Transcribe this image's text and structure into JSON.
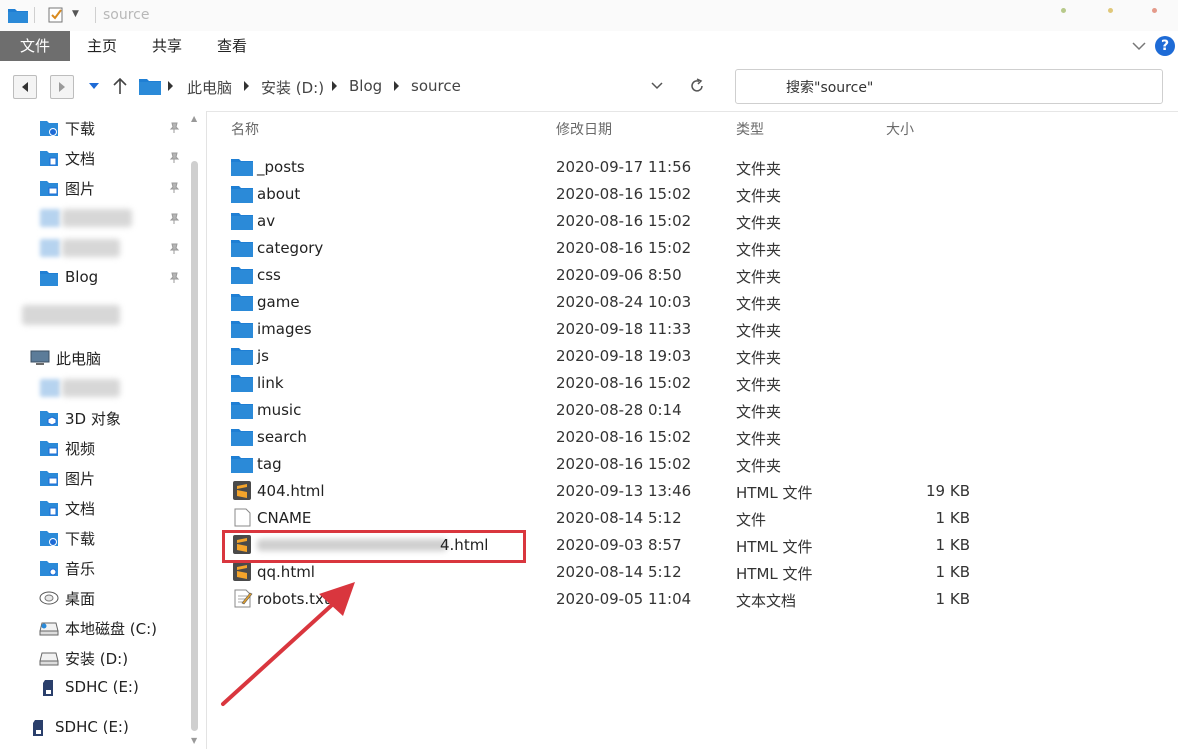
{
  "window": {
    "title": "source"
  },
  "ribbon": {
    "tabs": [
      "文件",
      "主页",
      "共享",
      "查看"
    ],
    "help": "?"
  },
  "address": {
    "breadcrumbs": [
      "此电脑",
      "安装 (D:)",
      "Blog",
      "source"
    ],
    "search_placeholder": "搜索\"source\""
  },
  "nav": {
    "quick_access": [
      {
        "label": "下载",
        "icon": "download-icon",
        "pinned": true
      },
      {
        "label": "文档",
        "icon": "document-icon",
        "pinned": true
      },
      {
        "label": "图片",
        "icon": "picture-icon",
        "pinned": true
      },
      {
        "label": "Blog",
        "icon": "folder-icon",
        "pinned": true
      }
    ],
    "this_pc": "此电脑",
    "pc_items": [
      {
        "label": "3D 对象",
        "icon": "3d-objects-icon"
      },
      {
        "label": "视频",
        "icon": "video-icon"
      },
      {
        "label": "图片",
        "icon": "picture-icon"
      },
      {
        "label": "文档",
        "icon": "document-icon"
      },
      {
        "label": "下载",
        "icon": "download-icon"
      },
      {
        "label": "音乐",
        "icon": "music-icon"
      },
      {
        "label": "桌面",
        "icon": "desktop-icon"
      },
      {
        "label": "本地磁盘 (C:)",
        "icon": "drive-icon"
      },
      {
        "label": "安装 (D:)",
        "icon": "drive-icon"
      },
      {
        "label": "SDHC (E:)",
        "icon": "sd-card-icon"
      }
    ],
    "extra": {
      "label": "SDHC (E:)",
      "icon": "sd-card-icon"
    }
  },
  "columns": {
    "name": "名称",
    "date": "修改日期",
    "type": "类型",
    "size": "大小"
  },
  "files": [
    {
      "name": "_posts",
      "date": "2020-09-17 11:56",
      "type": "文件夹",
      "size": "",
      "icon": "folder-icon"
    },
    {
      "name": "about",
      "date": "2020-08-16 15:02",
      "type": "文件夹",
      "size": "",
      "icon": "folder-icon"
    },
    {
      "name": "av",
      "date": "2020-08-16 15:02",
      "type": "文件夹",
      "size": "",
      "icon": "folder-icon"
    },
    {
      "name": "category",
      "date": "2020-08-16 15:02",
      "type": "文件夹",
      "size": "",
      "icon": "folder-icon"
    },
    {
      "name": "css",
      "date": "2020-09-06 8:50",
      "type": "文件夹",
      "size": "",
      "icon": "folder-icon"
    },
    {
      "name": "game",
      "date": "2020-08-24 10:03",
      "type": "文件夹",
      "size": "",
      "icon": "folder-icon"
    },
    {
      "name": "images",
      "date": "2020-09-18 11:33",
      "type": "文件夹",
      "size": "",
      "icon": "folder-icon"
    },
    {
      "name": "js",
      "date": "2020-09-18 19:03",
      "type": "文件夹",
      "size": "",
      "icon": "folder-icon"
    },
    {
      "name": "link",
      "date": "2020-08-16 15:02",
      "type": "文件夹",
      "size": "",
      "icon": "folder-icon"
    },
    {
      "name": "music",
      "date": "2020-08-28 0:14",
      "type": "文件夹",
      "size": "",
      "icon": "folder-icon"
    },
    {
      "name": "search",
      "date": "2020-08-16 15:02",
      "type": "文件夹",
      "size": "",
      "icon": "folder-icon"
    },
    {
      "name": "tag",
      "date": "2020-08-16 15:02",
      "type": "文件夹",
      "size": "",
      "icon": "folder-icon"
    },
    {
      "name": "404.html",
      "date": "2020-09-13 13:46",
      "type": "HTML 文件",
      "size": "19 KB",
      "icon": "sublime-icon"
    },
    {
      "name": "CNAME",
      "date": "2020-08-14 5:12",
      "type": "文件",
      "size": "1 KB",
      "icon": "blank-file-icon"
    },
    {
      "name": "4.html",
      "date": "2020-09-03 8:57",
      "type": "HTML 文件",
      "size": "1 KB",
      "icon": "sublime-icon",
      "obscured": true,
      "highlighted": true
    },
    {
      "name": "qq.html",
      "date": "2020-08-14 5:12",
      "type": "HTML 文件",
      "size": "1 KB",
      "icon": "sublime-icon"
    },
    {
      "name": "robots.txt",
      "date": "2020-09-05 11:04",
      "type": "文本文档",
      "size": "1 KB",
      "icon": "text-file-icon"
    }
  ],
  "colors": {
    "accent": "#1e6bd6",
    "folder": "#2b8ad8",
    "highlight": "#d9363e",
    "file_tab": "#6e6e6e"
  }
}
